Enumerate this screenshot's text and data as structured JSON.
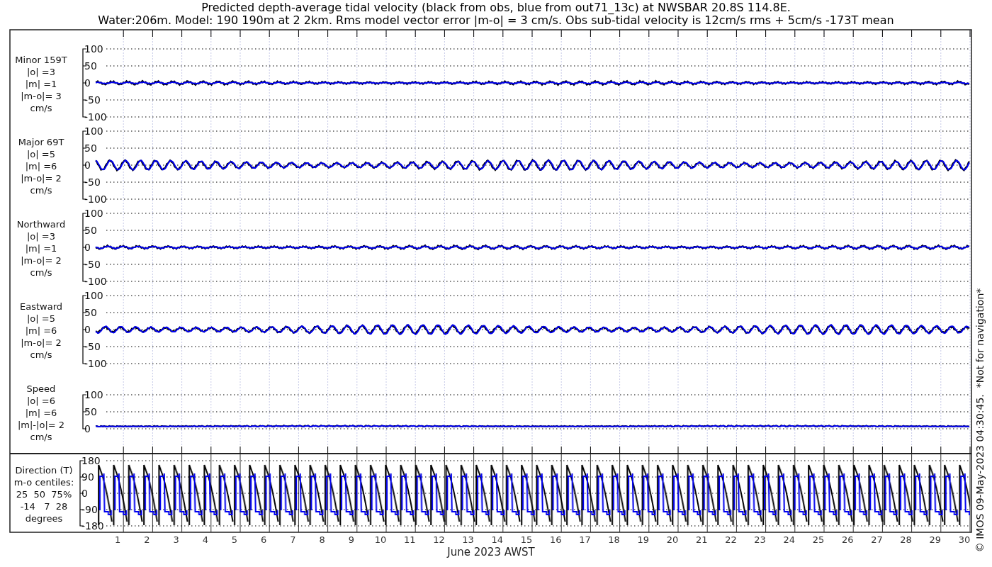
{
  "title": {
    "lines": [
      "Predicted depth-average tidal velocity (black from obs, blue from out71_13c) at NWSBAR 20.8S 114.8E.",
      "Water:206m. Model: 190 190m at 2 2km. Rms model vector error |m-o| = 3 cm/s. Obs sub-tidal velocity is 12cm/s rms + 5cm/s -173T mean"
    ]
  },
  "velocity_panels": [
    {
      "label_lines": [
        "Minor 159T",
        "|o| =3",
        "|m| =1",
        "|m-o|= 3",
        "cm/s"
      ],
      "yticks": [
        "100",
        "50",
        "0",
        "-50",
        "-100"
      ]
    },
    {
      "label_lines": [
        "Major 69T",
        "|o| =5",
        "|m| =6",
        "|m-o|= 2",
        "cm/s"
      ],
      "yticks": [
        "100",
        "50",
        "0",
        "-50",
        "-100"
      ]
    },
    {
      "label_lines": [
        "Northward",
        "|o| =3",
        "|m| =1",
        "|m-o|= 2",
        "cm/s"
      ],
      "yticks": [
        "100",
        "50",
        "0",
        "-50",
        "-100"
      ]
    },
    {
      "label_lines": [
        "Eastward",
        "|o| =5",
        "|m| =6",
        "|m-o|= 2",
        "cm/s"
      ],
      "yticks": [
        "100",
        "50",
        "0",
        "-50",
        "-100"
      ]
    },
    {
      "label_lines": [
        "Speed",
        "|o| =6",
        "|m| =6",
        "|m|-|o|= 2",
        "cm/s"
      ],
      "yticks": [
        "100",
        "50",
        "0"
      ]
    }
  ],
  "direction_panel": {
    "label_lines": [
      "Direction (T)",
      "m-o centiles:",
      "25  50  75%",
      "-14   7  28",
      "degrees"
    ],
    "yticks": [
      "180",
      "90",
      "0",
      "-90",
      "-180"
    ]
  },
  "x_axis": {
    "labels": [
      "1",
      "2",
      "3",
      "4",
      "5",
      "6",
      "7",
      "8",
      "9",
      "10",
      "11",
      "12",
      "13",
      "14",
      "15",
      "16",
      "17",
      "18",
      "19",
      "20",
      "21",
      "22",
      "23",
      "24",
      "25",
      "26",
      "27",
      "28",
      "29",
      "30"
    ],
    "title": "June 2023 AWST"
  },
  "footer_note": "© IMOS 09-May-2023 04:30:45.  *Not for navigation*"
}
